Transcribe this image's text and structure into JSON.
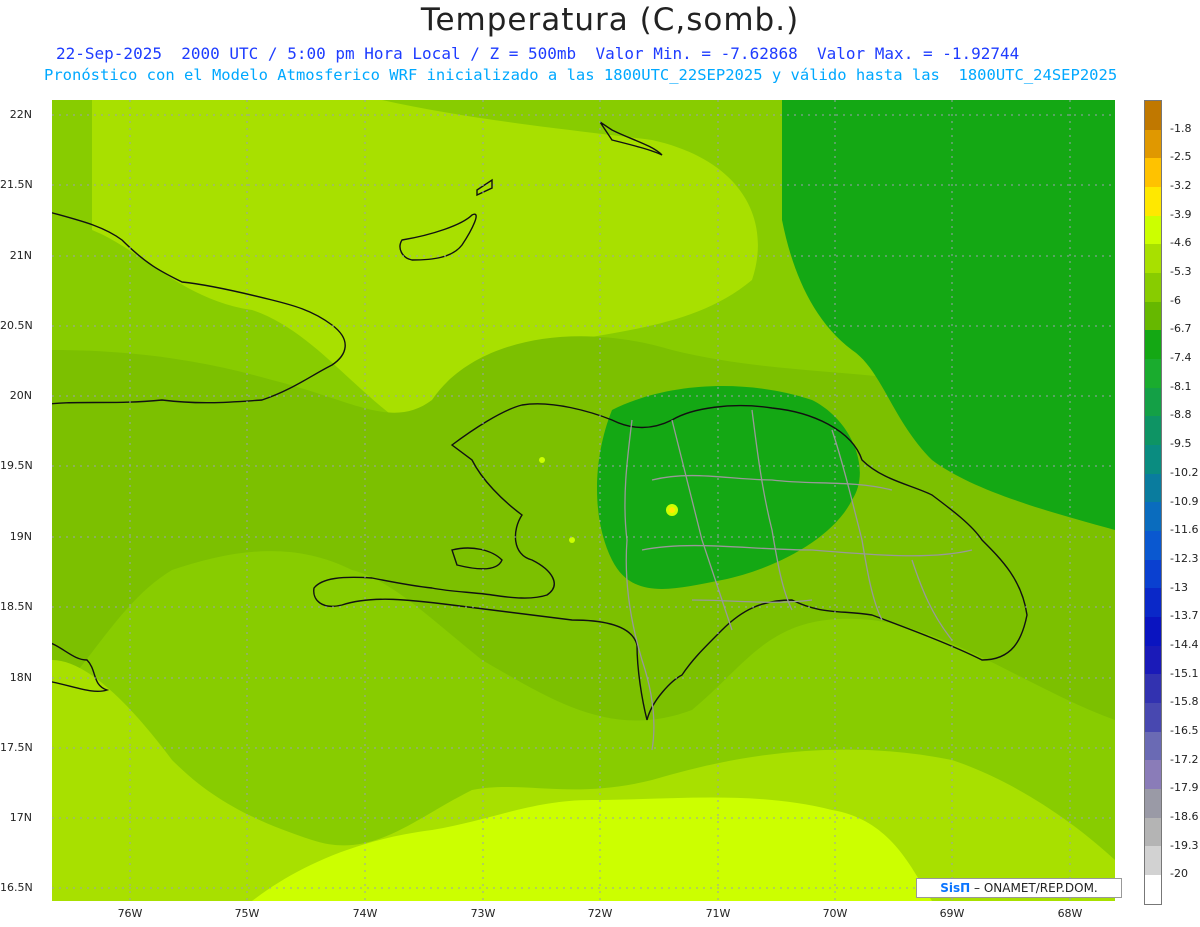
{
  "title": "Temperatura (C,somb.)",
  "subtitle_line1": "22-Sep-2025  2000 UTC / 5:00 pm Hora Local / Z = 500mb  Valor Min. = -7.62868  Valor Max. = -1.92744",
  "subtitle_line2": "Pronóstico con el Modelo Atmosferico WRF inicializado a las 1800UTC_22SEP2025 y válido hasta las  1800UTC_24SEP2025",
  "lat_labels": [
    "22N",
    "21.5N",
    "21N",
    "20.5N",
    "20N",
    "19.5N",
    "19N",
    "18.5N",
    "18N",
    "17.5N",
    "17N",
    "16.5N"
  ],
  "lon_labels": [
    "76W",
    "75W",
    "74W",
    "73W",
    "72W",
    "71W",
    "70W",
    "69W",
    "68W"
  ],
  "colorbar": {
    "labels": [
      "-1.8",
      "-2.5",
      "-3.2",
      "-3.9",
      "-4.6",
      "-5.3",
      "-6",
      "-6.7",
      "-7.4",
      "-8.1",
      "-8.8",
      "-9.5",
      "-10.2",
      "-10.9",
      "-11.6",
      "-12.3",
      "-13",
      "-13.7",
      "-14.4",
      "-15.1",
      "-15.8",
      "-16.5",
      "-17.2",
      "-17.9",
      "-18.6",
      "-19.3",
      "-20"
    ],
    "colors": [
      "#c07800",
      "#e09800",
      "#ffc200",
      "#ffe800",
      "#ccff00",
      "#a8e000",
      "#88cc00",
      "#66b800",
      "#14a814",
      "#1aac2e",
      "#14a046",
      "#0e9464",
      "#0a8c80",
      "#0a7c9e",
      "#0a6cbe",
      "#0a58d0",
      "#0a40d0",
      "#0a28c8",
      "#0a14c0",
      "#1a1ab8",
      "#3232b0",
      "#4848b0",
      "#6a6ab4",
      "#8a7cb8",
      "#9a9aa6",
      "#b4b4b4",
      "#d2d2d2",
      "#ffffff"
    ]
  },
  "credit": {
    "brand": "SisΠ",
    "rest": "– ONAMET/REP.DOM."
  }
}
